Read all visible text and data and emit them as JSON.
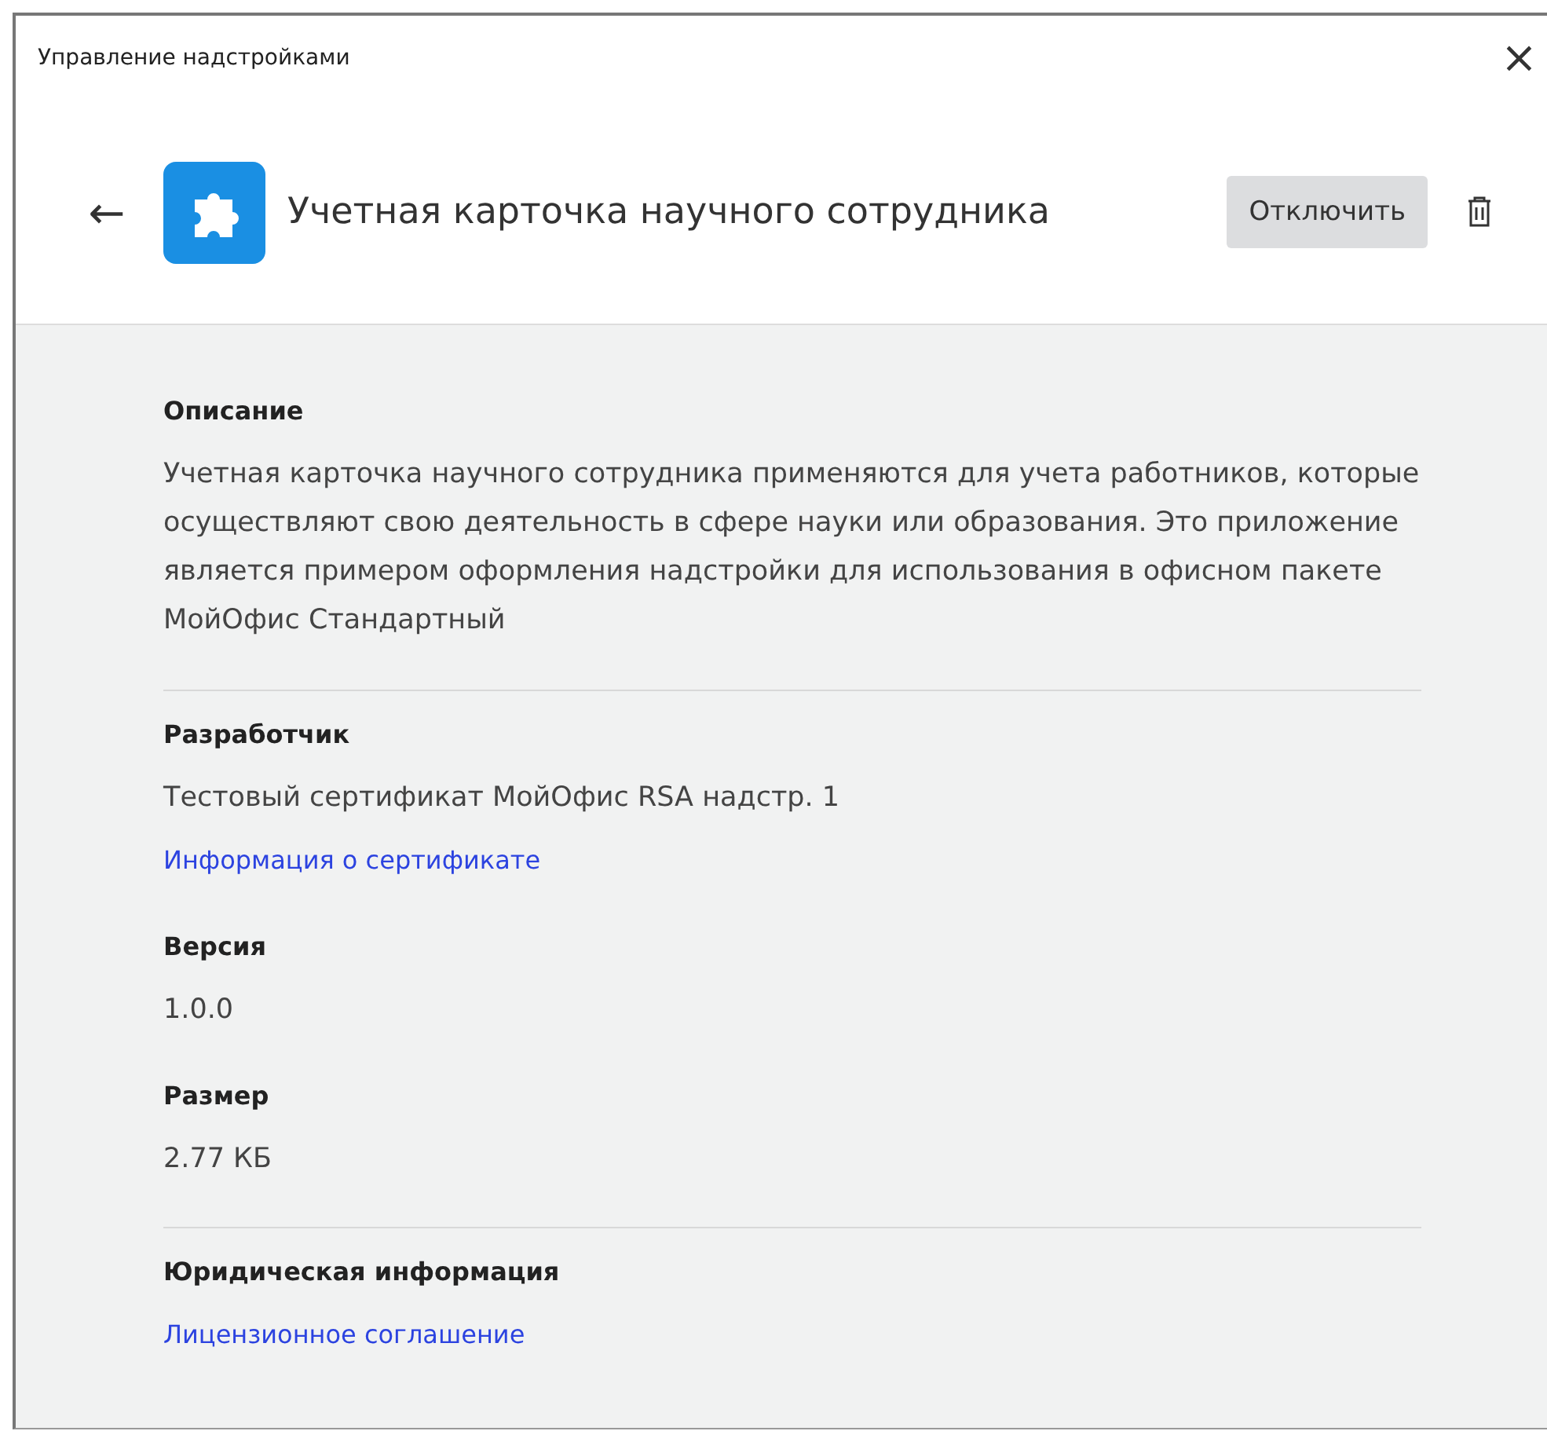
{
  "window": {
    "title": "Управление надстройками",
    "close": "×"
  },
  "header": {
    "back": "←",
    "name": "Учетная карточка научного сотрудника",
    "button": "Отключить"
  },
  "blocks": [
    {
      "kind": "heading",
      "text": "Описание"
    },
    {
      "kind": "paragraph",
      "text": "Учетная карточка научного сотрудника применяются для учета работников, которые осуществляют свою деятельность в сфере науки или образования. Это приложение является примером оформления надстройки для использования в офисном пакете МойОфис Стандартный"
    },
    {
      "kind": "divider"
    },
    {
      "kind": "heading",
      "text": "Разработчик"
    },
    {
      "kind": "value",
      "text": "Тестовый сертификат МойОфис RSA надстр. 1"
    },
    {
      "kind": "link",
      "text": "Информация о сертификате"
    },
    {
      "kind": "heading",
      "text": "Версия"
    },
    {
      "kind": "value",
      "text": "1.0.0"
    },
    {
      "kind": "heading",
      "text": "Размер"
    },
    {
      "kind": "value",
      "text": "2.77 КБ"
    },
    {
      "kind": "divider"
    },
    {
      "kind": "heading",
      "text": "Юридическая информация"
    },
    {
      "kind": "link",
      "text": "Лицензионное соглашение"
    }
  ]
}
